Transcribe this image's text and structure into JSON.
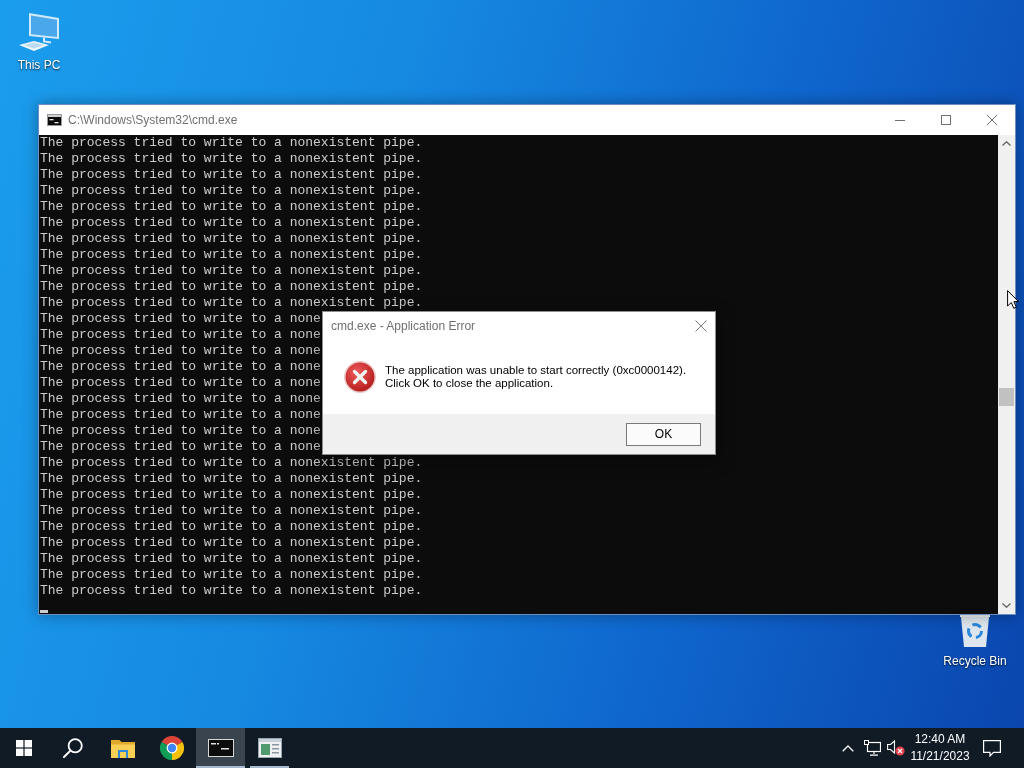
{
  "desktop_icons": [
    {
      "kind": "computer",
      "label": "This PC"
    },
    {
      "kind": "bin",
      "label": "Recycle Bin"
    }
  ],
  "console_window": {
    "title": "C:\\Windows\\System32\\cmd.exe",
    "lines": [
      "The process tried to write to a nonexistent pipe.",
      "The process tried to write to a nonexistent pipe.",
      "The process tried to write to a nonexistent pipe.",
      "The process tried to write to a nonexistent pipe.",
      "The process tried to write to a nonexistent pipe.",
      "The process tried to write to a nonexistent pipe.",
      "The process tried to write to a nonexistent pipe.",
      "The process tried to write to a nonexistent pipe.",
      "The process tried to write to a nonexistent pipe.",
      "The process tried to write to a nonexistent pipe.",
      "The process tried to write to a nonexistent pipe.",
      "The process tried to write to a none",
      "The process tried to write to a none",
      "The process tried to write to a none",
      "The process tried to write to a none",
      "The process tried to write to a none",
      "The process tried to write to a none",
      "The process tried to write to a none",
      "The process tried to write to a none",
      "The process tried to write to a none",
      "The process tried to write to a nonexistent pipe.",
      "The process tried to write to a nonexistent pipe.",
      "The process tried to write to a nonexistent pipe.",
      "The process tried to write to a nonexistent pipe.",
      "The process tried to write to a nonexistent pipe.",
      "The process tried to write to a nonexistent pipe.",
      "The process tried to write to a nonexistent pipe.",
      "The process tried to write to a nonexistent pipe.",
      "The process tried to write to a nonexistent pipe."
    ]
  },
  "error_dialog": {
    "title": "cmd.exe - Application Error",
    "message": "The application was unable to start correctly (0xc0000142).\nClick OK to close the application.",
    "buttons": [
      "OK"
    ]
  },
  "taskbar": {
    "apps": [
      {
        "kind": "folder",
        "active": false,
        "running": false
      },
      {
        "kind": "browser",
        "active": false,
        "running": false
      },
      {
        "kind": "terminal",
        "active": true,
        "running": true
      },
      {
        "kind": "window",
        "active": false,
        "running": true
      }
    ],
    "tray": {
      "volume_muted": true,
      "time": "12:40 AM",
      "date": "11/21/2023"
    }
  }
}
